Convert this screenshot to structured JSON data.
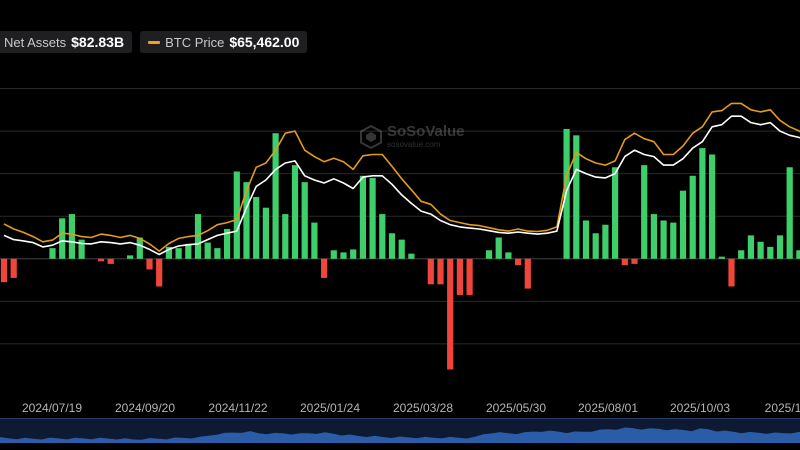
{
  "legend": {
    "items": [
      {
        "label": "Net Assets",
        "value": "$82.83B",
        "color": ""
      },
      {
        "label": "BTC Price",
        "value": "$65,462.00",
        "color": "#f0a020"
      }
    ]
  },
  "watermark": {
    "brand": "SoSoValue",
    "url": "sosovalue.com"
  },
  "chart_data": {
    "type": "bar",
    "x_ticks": [
      "2024/07/19",
      "2024/09/20",
      "2024/11/22",
      "2025/01/24",
      "2025/03/28",
      "2025/05/30",
      "2025/08/01",
      "2025/10/03",
      "2025/1"
    ],
    "flows": [
      -0.55,
      -0.45,
      0,
      0,
      0,
      0.25,
      0.95,
      1.05,
      0.45,
      0,
      -0.06,
      -0.12,
      0,
      0.08,
      0.5,
      -0.25,
      -0.65,
      0.28,
      0.25,
      0.35,
      1.05,
      0.38,
      0.25,
      0.7,
      2.05,
      1.8,
      1.45,
      1.2,
      2.95,
      1.05,
      2.2,
      1.8,
      0.85,
      -0.45,
      0.2,
      0.15,
      0.22,
      1.95,
      1.9,
      1.05,
      0.6,
      0.45,
      0.12,
      0,
      -0.6,
      -0.6,
      -2.6,
      -0.85,
      -0.85,
      0,
      0.2,
      0.5,
      0.15,
      -0.15,
      -0.7,
      0,
      0,
      0,
      3.05,
      2.9,
      0.9,
      0.6,
      0.8,
      2.15,
      -0.15,
      -0.12,
      2.2,
      1.05,
      0.9,
      0.85,
      1.6,
      1.95,
      2.6,
      2.45,
      0.05,
      -0.65,
      0.2,
      0.55,
      0.4,
      0.28,
      0.55,
      2.15,
      0.2,
      3.1,
      2.55,
      0,
      0,
      0.45,
      -0.85,
      -1.1,
      -1.1,
      -1.15,
      -1.2,
      0.07,
      -0.07,
      -0.07,
      -0.5
    ],
    "btc_price": [
      0.82,
      0.7,
      0.62,
      0.52,
      0.4,
      0.44,
      0.6,
      0.58,
      0.52,
      0.5,
      0.58,
      0.55,
      0.5,
      0.55,
      0.48,
      0.35,
      0.18,
      0.36,
      0.48,
      0.52,
      0.55,
      0.66,
      0.8,
      0.85,
      0.92,
      1.6,
      2.15,
      2.25,
      2.55,
      2.95,
      3.0,
      2.55,
      2.4,
      2.28,
      2.36,
      2.28,
      2.1,
      2.42,
      2.45,
      2.45,
      2.17,
      1.88,
      1.62,
      1.35,
      1.28,
      1.05,
      0.9,
      0.85,
      0.8,
      0.78,
      0.73,
      0.68,
      0.65,
      0.7,
      0.65,
      0.64,
      0.67,
      0.75,
      1.95,
      2.5,
      2.35,
      2.25,
      2.2,
      2.3,
      2.8,
      2.95,
      2.82,
      2.75,
      2.45,
      2.45,
      2.65,
      2.95,
      3.1,
      3.45,
      3.48,
      3.65,
      3.65,
      3.5,
      3.45,
      3.5,
      3.25,
      3.1,
      3.0,
      2.85,
      3.4,
      3.3,
      2.85,
      2.6,
      2.45,
      2.2,
      2.1,
      2.05,
      1.95,
      1.95,
      2.0,
      2.15,
      2.18
    ],
    "net_assets": [
      0.55,
      0.45,
      0.42,
      0.38,
      0.28,
      0.32,
      0.42,
      0.4,
      0.36,
      0.35,
      0.4,
      0.38,
      0.35,
      0.38,
      0.32,
      0.22,
      0.1,
      0.22,
      0.3,
      0.33,
      0.35,
      0.45,
      0.55,
      0.6,
      0.65,
      1.2,
      1.7,
      1.85,
      2.1,
      2.25,
      2.3,
      1.95,
      1.85,
      1.78,
      1.88,
      1.78,
      1.65,
      1.92,
      1.95,
      1.95,
      1.75,
      1.5,
      1.3,
      1.12,
      1.05,
      0.9,
      0.8,
      0.75,
      0.72,
      0.7,
      0.66,
      0.62,
      0.6,
      0.63,
      0.6,
      0.58,
      0.6,
      0.65,
      1.6,
      2.1,
      2.0,
      1.92,
      1.9,
      2.0,
      2.4,
      2.55,
      2.45,
      2.4,
      2.2,
      2.2,
      2.35,
      2.6,
      2.75,
      3.1,
      3.15,
      3.35,
      3.35,
      3.2,
      3.15,
      3.2,
      3.0,
      2.9,
      2.85,
      2.7,
      3.1,
      3.05,
      2.65,
      2.45,
      2.35,
      2.15,
      2.08,
      2.05,
      1.95,
      1.9,
      1.95,
      2.1,
      2.12
    ],
    "y_range": [
      -3.2,
      4.2
    ],
    "grid": true,
    "legend_position": "top-left",
    "colors": {
      "inflow": "#3ecf6a",
      "outflow": "#f0453a",
      "btc_price": "#e49b1a",
      "net_assets": "#ffffff",
      "grid": "#2a2a2a",
      "tick_label": "#b5b5b5",
      "navigator_fill": "#2f64b4"
    }
  }
}
